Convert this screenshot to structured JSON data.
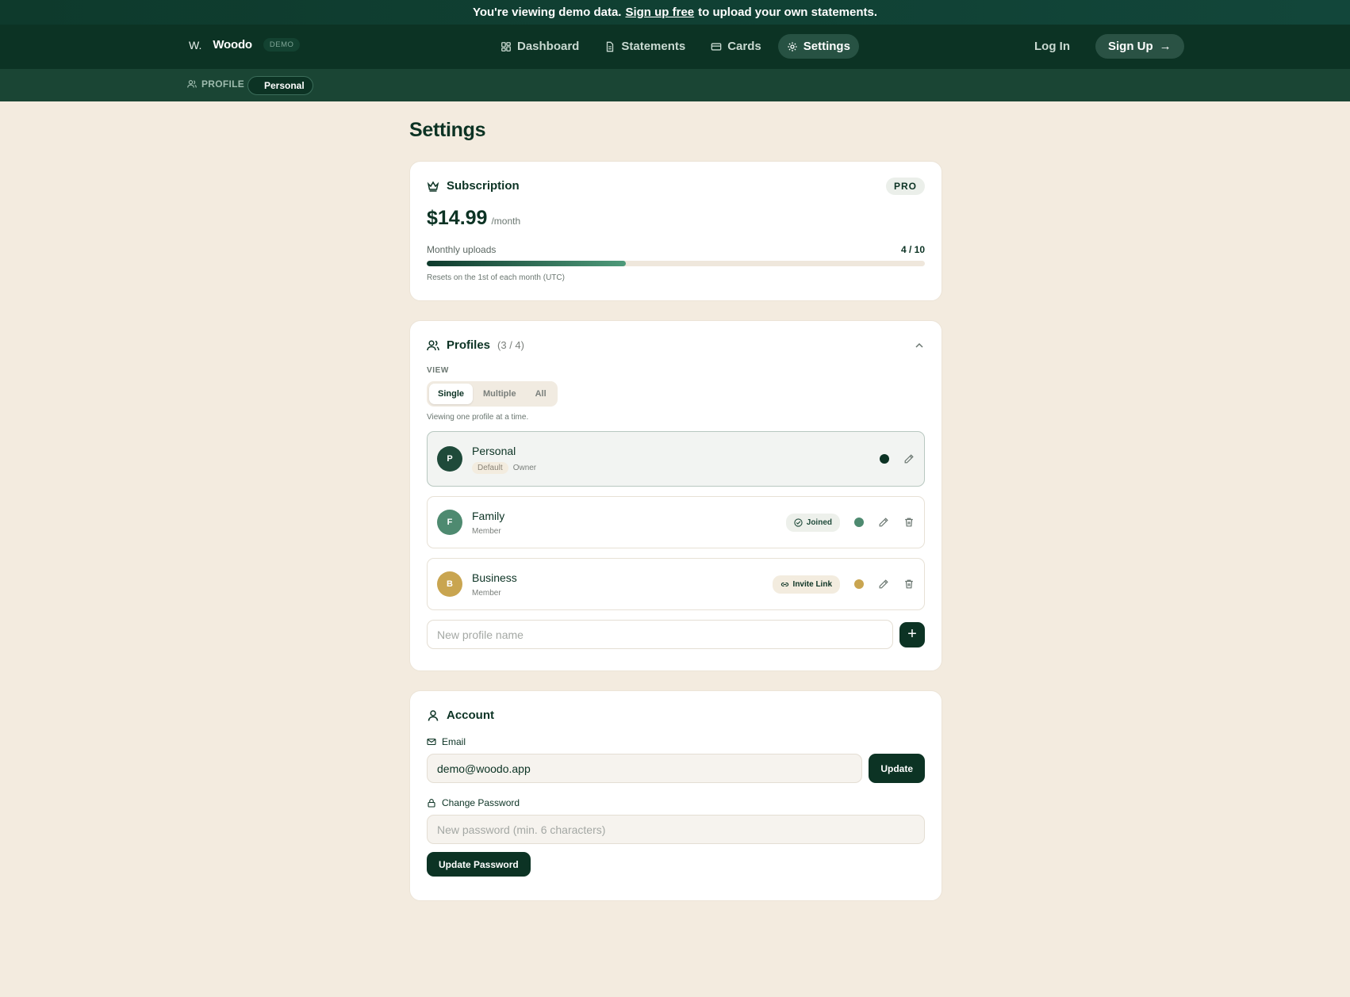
{
  "banner": {
    "prefix": "You're viewing demo data.",
    "link": "Sign up free",
    "suffix": "to upload your own statements."
  },
  "brand": {
    "mark": "W.",
    "name": "Woodo",
    "tag": "DEMO"
  },
  "nav": {
    "items": [
      {
        "label": "Dashboard",
        "icon": "dashboard-icon"
      },
      {
        "label": "Statements",
        "icon": "document-icon"
      },
      {
        "label": "Cards",
        "icon": "card-icon"
      },
      {
        "label": "Settings",
        "icon": "gear-icon",
        "active": true
      }
    ],
    "login": "Log In",
    "signup": "Sign Up"
  },
  "subbar": {
    "label": "PROFILE",
    "current": "Personal"
  },
  "page": {
    "title": "Settings"
  },
  "subscription": {
    "title": "Subscription",
    "plan": "PRO",
    "price": "$14.99",
    "period": "/month",
    "uploads_label": "Monthly uploads",
    "uploads_count": "4 / 10",
    "uploads_fraction": 0.4,
    "reset_note": "Resets on the 1st of each month (UTC)"
  },
  "profiles": {
    "title": "Profiles",
    "count": "(3 / 4)",
    "view_label": "VIEW",
    "view_options": [
      "Single",
      "Multiple",
      "All"
    ],
    "view_selected": "Single",
    "view_note": "Viewing one profile at a time.",
    "items": [
      {
        "initial": "P",
        "name": "Personal",
        "tag": "Default",
        "role": "Owner",
        "color": "#1f4a3a"
      },
      {
        "initial": "F",
        "name": "Family",
        "role": "Member",
        "badge": "Joined",
        "color": "#4e8a70"
      },
      {
        "initial": "B",
        "name": "Business",
        "role": "Member",
        "badge": "Invite Link",
        "color": "#c9a550"
      }
    ],
    "new_placeholder": "New profile name",
    "add_label": "+"
  },
  "account": {
    "title": "Account",
    "email_label": "Email",
    "email_value": "demo@woodo.app",
    "update_label": "Update",
    "password_label": "Change Password",
    "password_placeholder": "New password (min. 6 characters)",
    "update_password_label": "Update Password"
  },
  "colors": {
    "primary": "#0c3324",
    "background": "#f3ebdf",
    "accent": "#4e8a70",
    "gold": "#c9a550"
  }
}
